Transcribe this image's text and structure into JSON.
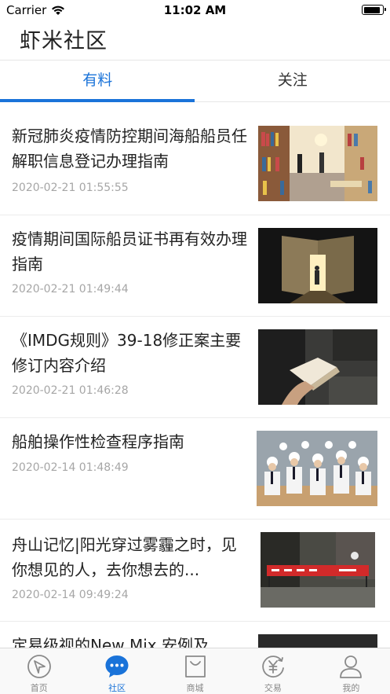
{
  "status_bar": {
    "carrier": "Carrier",
    "time": "11:02 AM",
    "battery_level": 0.95
  },
  "header": {
    "title": "虾米社区"
  },
  "tabs": [
    {
      "label": "有料",
      "active": true
    },
    {
      "label": "关注",
      "active": false
    }
  ],
  "feed": [
    {
      "title": "新冠肺炎疫情防控期间海船船员任解职信息登记办理指南",
      "time": "2020-02-21 01:55:55",
      "image": "library-bookshelves-photo"
    },
    {
      "title": "疫情期间国际船员证书再有效办理指南",
      "time": "2020-02-21 01:49:44",
      "image": "giant-open-book-photo"
    },
    {
      "title": "《IMDG规则》39-18修正案主要修订内容介绍",
      "time": "2020-02-21 01:46:28",
      "image": "reading-book-photo"
    },
    {
      "title": "船舶操作性检查程序指南",
      "time": "2020-02-14 01:48:49",
      "image": "sailors-in-uniform-photo"
    },
    {
      "title": "舟山记忆|阳光穿过雾霾之时，见你想见的人，去你想去的...",
      "time": "2020-02-14 09:49:24",
      "image": "street-banner-photo"
    },
    {
      "title": "定易级视的New Mix 安例及"
    }
  ],
  "tabbar": [
    {
      "label": "首页",
      "icon": "compass-icon",
      "active": false
    },
    {
      "label": "社区",
      "icon": "chat-bubble-icon",
      "active": true
    },
    {
      "label": "商城",
      "icon": "shopping-bag-icon",
      "active": false
    },
    {
      "label": "交易",
      "icon": "yuan-exchange-icon",
      "active": false
    },
    {
      "label": "我的",
      "icon": "user-icon",
      "active": false
    }
  ],
  "colors": {
    "accent": "#1a73d9",
    "text": "#222222",
    "muted": "#a6a6a6",
    "divider": "#ececec"
  }
}
